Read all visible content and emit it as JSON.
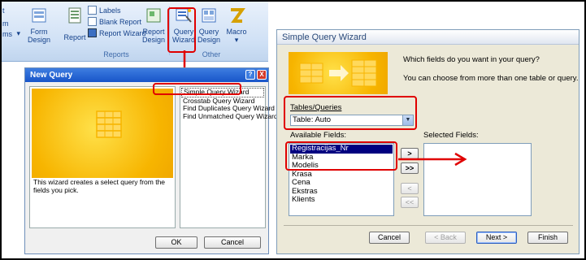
{
  "ribbon": {
    "partial_labels": {
      "t": "t",
      "m": "m",
      "ms": "ms"
    },
    "form": {
      "line1": "Form",
      "line2": "Design"
    },
    "report": "Report",
    "labels": "Labels",
    "blank_report": "Blank Report",
    "report_wizard": "Report Wizard",
    "report_design": {
      "line1": "Report",
      "line2": "Design"
    },
    "query_wizard": {
      "line1": "Query",
      "line2": "Wizard"
    },
    "query_design": {
      "line1": "Query",
      "line2": "Design"
    },
    "macro": "Macro",
    "group_reports": "Reports",
    "group_other": "Other"
  },
  "new_query": {
    "title": "New Query",
    "description": "This wizard creates a select query from the fields you pick.",
    "items": [
      "Simple Query Wizard",
      "Crosstab Query Wizard",
      "Find Duplicates Query Wizard",
      "Find Unmatched Query Wizard"
    ],
    "ok": "OK",
    "cancel": "Cancel",
    "help_btn": "?",
    "close_btn": "X"
  },
  "wizard": {
    "title": "Simple Query Wizard",
    "question": "Which fields do you want in your query?",
    "hint": "You can choose from more than one table or query.",
    "tables_label": "Tables/Queries",
    "table_value": "Table: Auto",
    "available_label": "Available Fields:",
    "selected_label": "Selected Fields:",
    "fields": [
      "Registracijas_Nr",
      "Marka",
      "Modelis",
      "Krasa",
      "Cena",
      "Ekstras",
      "Klients"
    ],
    "move_buttons": {
      "add_one": ">",
      "add_all": ">>",
      "remove_one": "<",
      "remove_all": "<<"
    },
    "cancel": "Cancel",
    "back": "< Back",
    "next": "Next >",
    "finish": "Finish"
  },
  "colors": {
    "highlight": "#e00000",
    "title_bar": "#1855c9",
    "accent_yellow": "#f7b500"
  }
}
